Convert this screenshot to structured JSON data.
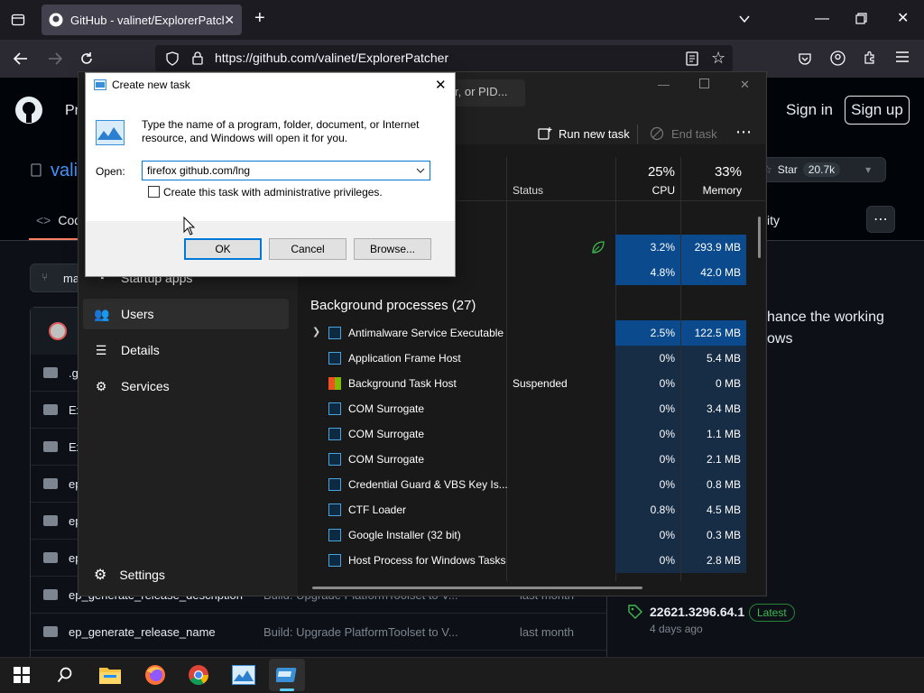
{
  "browser": {
    "tab_title": "GitHub - valinet/ExplorerPatcher",
    "url": "https://github.com/valinet/ExplorerPatcher"
  },
  "github": {
    "nav_partial": "Pr",
    "sign_in": "Sign in",
    "sign_up": "Sign up",
    "repo_partial": "vali",
    "star_label": "Star",
    "star_count": "20.7k",
    "tab_code_partial": "Cod",
    "tab_activity_partial": "ity",
    "branch_partial": "ma",
    "about_line1": "hance the working",
    "about_line2": "ows",
    "release_version": "22621.3296.64.1",
    "release_badge": "Latest",
    "release_date": "4 days ago",
    "files": [
      {
        "name": ".g",
        "msg": "",
        "when": ""
      },
      {
        "name": "Ex",
        "msg": "",
        "when": ""
      },
      {
        "name": "Ex",
        "msg": "",
        "when": ""
      },
      {
        "name": "ep",
        "msg": "",
        "when": ""
      },
      {
        "name": "ep",
        "msg": "",
        "when": ""
      },
      {
        "name": "ep",
        "msg": "",
        "when": ""
      },
      {
        "name": "ep_generate_release_description",
        "msg": "Build: Upgrade PlatformToolset to V...",
        "when": "last month"
      },
      {
        "name": "ep_generate_release_name",
        "msg": "Build: Upgrade PlatformToolset to V...",
        "when": "last month"
      }
    ]
  },
  "taskmgr": {
    "search_partial": "r, or PID...",
    "run_new_task": "Run new task",
    "end_task": "End task",
    "sidebar": [
      {
        "label": "Startup apps",
        "icon": "startup-icon"
      },
      {
        "label": "Users",
        "icon": "users-icon"
      },
      {
        "label": "Details",
        "icon": "details-icon"
      },
      {
        "label": "Services",
        "icon": "services-icon"
      }
    ],
    "settings": "Settings",
    "col_status": "Status",
    "cpu_pct": "25%",
    "cpu_label": "CPU",
    "mem_pct": "33%",
    "mem_label": "Memory",
    "top_rows": [
      {
        "cpu": "3.2%",
        "mem": "293.9 MB"
      },
      {
        "cpu": "4.8%",
        "mem": "42.0 MB"
      }
    ],
    "bg_header": "Background processes (27)",
    "processes": [
      {
        "name": "Antimalware Service Executable",
        "status": "",
        "cpu": "2.5%",
        "mem": "122.5 MB"
      },
      {
        "name": "Application Frame Host",
        "status": "",
        "cpu": "0%",
        "mem": "5.4 MB"
      },
      {
        "name": "Background Task Host",
        "status": "Suspended",
        "cpu": "0%",
        "mem": "0 MB"
      },
      {
        "name": "COM Surrogate",
        "status": "",
        "cpu": "0%",
        "mem": "3.4 MB"
      },
      {
        "name": "COM Surrogate",
        "status": "",
        "cpu": "0%",
        "mem": "1.1 MB"
      },
      {
        "name": "COM Surrogate",
        "status": "",
        "cpu": "0%",
        "mem": "2.1 MB"
      },
      {
        "name": "Credential Guard & VBS Key Is...",
        "status": "",
        "cpu": "0%",
        "mem": "0.8 MB"
      },
      {
        "name": "CTF Loader",
        "status": "",
        "cpu": "0.8%",
        "mem": "4.5 MB"
      },
      {
        "name": "Google Installer (32 bit)",
        "status": "",
        "cpu": "0%",
        "mem": "0.3 MB"
      },
      {
        "name": "Host Process for Windows Tasks",
        "status": "",
        "cpu": "0%",
        "mem": "2.8 MB"
      }
    ]
  },
  "run_dialog": {
    "title": "Create new task",
    "description": "Type the name of a program, folder, document, or Internet resource, and Windows will open it for you.",
    "open_label": "Open:",
    "input_value": "firefox github.com/lng",
    "admin_label": "Create this task with administrative privileges.",
    "ok": "OK",
    "cancel": "Cancel",
    "browse": "Browse..."
  },
  "colors": {
    "accent": "#0078d7",
    "gh_bg": "#0d1117",
    "tm_bg": "#202020"
  }
}
